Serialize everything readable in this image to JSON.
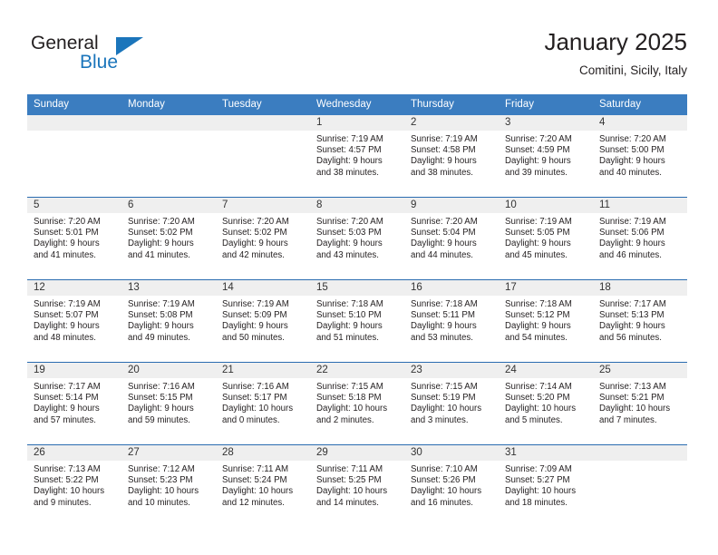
{
  "brand": {
    "name_part1": "General",
    "name_part2": "Blue",
    "accent_color": "#1b75bb",
    "logo_icon": "triangle-flag-icon"
  },
  "header": {
    "title": "January 2025",
    "location": "Comitini, Sicily, Italy"
  },
  "theme": {
    "header_bg": "#3b7dc0",
    "row_divider": "#2a6cb0",
    "daynum_band": "#efefef",
    "text": "#231f20"
  },
  "calendar": {
    "weekday_headers": [
      "Sunday",
      "Monday",
      "Tuesday",
      "Wednesday",
      "Thursday",
      "Friday",
      "Saturday"
    ],
    "weeks": [
      [
        {
          "day": "",
          "empty": true
        },
        {
          "day": "",
          "empty": true
        },
        {
          "day": "",
          "empty": true
        },
        {
          "day": "1",
          "sunrise": "Sunrise: 7:19 AM",
          "sunset": "Sunset: 4:57 PM",
          "daylight_1": "Daylight: 9 hours",
          "daylight_2": "and 38 minutes."
        },
        {
          "day": "2",
          "sunrise": "Sunrise: 7:19 AM",
          "sunset": "Sunset: 4:58 PM",
          "daylight_1": "Daylight: 9 hours",
          "daylight_2": "and 38 minutes."
        },
        {
          "day": "3",
          "sunrise": "Sunrise: 7:20 AM",
          "sunset": "Sunset: 4:59 PM",
          "daylight_1": "Daylight: 9 hours",
          "daylight_2": "and 39 minutes."
        },
        {
          "day": "4",
          "sunrise": "Sunrise: 7:20 AM",
          "sunset": "Sunset: 5:00 PM",
          "daylight_1": "Daylight: 9 hours",
          "daylight_2": "and 40 minutes."
        }
      ],
      [
        {
          "day": "5",
          "sunrise": "Sunrise: 7:20 AM",
          "sunset": "Sunset: 5:01 PM",
          "daylight_1": "Daylight: 9 hours",
          "daylight_2": "and 41 minutes."
        },
        {
          "day": "6",
          "sunrise": "Sunrise: 7:20 AM",
          "sunset": "Sunset: 5:02 PM",
          "daylight_1": "Daylight: 9 hours",
          "daylight_2": "and 41 minutes."
        },
        {
          "day": "7",
          "sunrise": "Sunrise: 7:20 AM",
          "sunset": "Sunset: 5:02 PM",
          "daylight_1": "Daylight: 9 hours",
          "daylight_2": "and 42 minutes."
        },
        {
          "day": "8",
          "sunrise": "Sunrise: 7:20 AM",
          "sunset": "Sunset: 5:03 PM",
          "daylight_1": "Daylight: 9 hours",
          "daylight_2": "and 43 minutes."
        },
        {
          "day": "9",
          "sunrise": "Sunrise: 7:20 AM",
          "sunset": "Sunset: 5:04 PM",
          "daylight_1": "Daylight: 9 hours",
          "daylight_2": "and 44 minutes."
        },
        {
          "day": "10",
          "sunrise": "Sunrise: 7:19 AM",
          "sunset": "Sunset: 5:05 PM",
          "daylight_1": "Daylight: 9 hours",
          "daylight_2": "and 45 minutes."
        },
        {
          "day": "11",
          "sunrise": "Sunrise: 7:19 AM",
          "sunset": "Sunset: 5:06 PM",
          "daylight_1": "Daylight: 9 hours",
          "daylight_2": "and 46 minutes."
        }
      ],
      [
        {
          "day": "12",
          "sunrise": "Sunrise: 7:19 AM",
          "sunset": "Sunset: 5:07 PM",
          "daylight_1": "Daylight: 9 hours",
          "daylight_2": "and 48 minutes."
        },
        {
          "day": "13",
          "sunrise": "Sunrise: 7:19 AM",
          "sunset": "Sunset: 5:08 PM",
          "daylight_1": "Daylight: 9 hours",
          "daylight_2": "and 49 minutes."
        },
        {
          "day": "14",
          "sunrise": "Sunrise: 7:19 AM",
          "sunset": "Sunset: 5:09 PM",
          "daylight_1": "Daylight: 9 hours",
          "daylight_2": "and 50 minutes."
        },
        {
          "day": "15",
          "sunrise": "Sunrise: 7:18 AM",
          "sunset": "Sunset: 5:10 PM",
          "daylight_1": "Daylight: 9 hours",
          "daylight_2": "and 51 minutes."
        },
        {
          "day": "16",
          "sunrise": "Sunrise: 7:18 AM",
          "sunset": "Sunset: 5:11 PM",
          "daylight_1": "Daylight: 9 hours",
          "daylight_2": "and 53 minutes."
        },
        {
          "day": "17",
          "sunrise": "Sunrise: 7:18 AM",
          "sunset": "Sunset: 5:12 PM",
          "daylight_1": "Daylight: 9 hours",
          "daylight_2": "and 54 minutes."
        },
        {
          "day": "18",
          "sunrise": "Sunrise: 7:17 AM",
          "sunset": "Sunset: 5:13 PM",
          "daylight_1": "Daylight: 9 hours",
          "daylight_2": "and 56 minutes."
        }
      ],
      [
        {
          "day": "19",
          "sunrise": "Sunrise: 7:17 AM",
          "sunset": "Sunset: 5:14 PM",
          "daylight_1": "Daylight: 9 hours",
          "daylight_2": "and 57 minutes."
        },
        {
          "day": "20",
          "sunrise": "Sunrise: 7:16 AM",
          "sunset": "Sunset: 5:15 PM",
          "daylight_1": "Daylight: 9 hours",
          "daylight_2": "and 59 minutes."
        },
        {
          "day": "21",
          "sunrise": "Sunrise: 7:16 AM",
          "sunset": "Sunset: 5:17 PM",
          "daylight_1": "Daylight: 10 hours",
          "daylight_2": "and 0 minutes."
        },
        {
          "day": "22",
          "sunrise": "Sunrise: 7:15 AM",
          "sunset": "Sunset: 5:18 PM",
          "daylight_1": "Daylight: 10 hours",
          "daylight_2": "and 2 minutes."
        },
        {
          "day": "23",
          "sunrise": "Sunrise: 7:15 AM",
          "sunset": "Sunset: 5:19 PM",
          "daylight_1": "Daylight: 10 hours",
          "daylight_2": "and 3 minutes."
        },
        {
          "day": "24",
          "sunrise": "Sunrise: 7:14 AM",
          "sunset": "Sunset: 5:20 PM",
          "daylight_1": "Daylight: 10 hours",
          "daylight_2": "and 5 minutes."
        },
        {
          "day": "25",
          "sunrise": "Sunrise: 7:13 AM",
          "sunset": "Sunset: 5:21 PM",
          "daylight_1": "Daylight: 10 hours",
          "daylight_2": "and 7 minutes."
        }
      ],
      [
        {
          "day": "26",
          "sunrise": "Sunrise: 7:13 AM",
          "sunset": "Sunset: 5:22 PM",
          "daylight_1": "Daylight: 10 hours",
          "daylight_2": "and 9 minutes."
        },
        {
          "day": "27",
          "sunrise": "Sunrise: 7:12 AM",
          "sunset": "Sunset: 5:23 PM",
          "daylight_1": "Daylight: 10 hours",
          "daylight_2": "and 10 minutes."
        },
        {
          "day": "28",
          "sunrise": "Sunrise: 7:11 AM",
          "sunset": "Sunset: 5:24 PM",
          "daylight_1": "Daylight: 10 hours",
          "daylight_2": "and 12 minutes."
        },
        {
          "day": "29",
          "sunrise": "Sunrise: 7:11 AM",
          "sunset": "Sunset: 5:25 PM",
          "daylight_1": "Daylight: 10 hours",
          "daylight_2": "and 14 minutes."
        },
        {
          "day": "30",
          "sunrise": "Sunrise: 7:10 AM",
          "sunset": "Sunset: 5:26 PM",
          "daylight_1": "Daylight: 10 hours",
          "daylight_2": "and 16 minutes."
        },
        {
          "day": "31",
          "sunrise": "Sunrise: 7:09 AM",
          "sunset": "Sunset: 5:27 PM",
          "daylight_1": "Daylight: 10 hours",
          "daylight_2": "and 18 minutes."
        },
        {
          "day": "",
          "empty": true
        }
      ]
    ]
  }
}
